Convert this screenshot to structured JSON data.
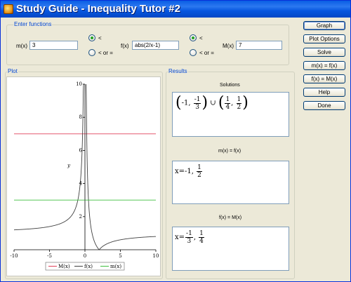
{
  "window": {
    "title": "Study Guide - Inequality Tutor #2"
  },
  "functions": {
    "group_label": "Enter functions",
    "m_label": "m(x)",
    "m_value": "3",
    "f_label": "f(x)",
    "f_value": "abs(2/x-1)",
    "M_label": "M(x)",
    "M_value": "7",
    "left_options": {
      "lt": "<",
      "le": "< or =",
      "selected": "lt"
    },
    "right_options": {
      "lt": "<",
      "le": "< or =",
      "selected": "lt"
    }
  },
  "plot": {
    "group_label": "Plot",
    "legend": [
      "M(x)",
      "f(x)",
      "m(x)"
    ]
  },
  "results": {
    "group_label": "Results",
    "solutions_title": "Solutions",
    "mf_title": "m(x) = f(x)",
    "fM_title": "f(x) = M(x)",
    "solutions": {
      "a1": "-1",
      "b1_num": "-1",
      "b1_den": "3",
      "union": "∪",
      "a2_num": "1",
      "a2_den": "4",
      "b2_num": "1",
      "b2_den": "2"
    },
    "mf": {
      "prefix": "x=",
      "v1": "-1",
      "v2_num": "1",
      "v2_den": "2"
    },
    "fM": {
      "prefix": "x=",
      "v1_num": "-1",
      "v1_den": "3",
      "v2_num": "1",
      "v2_den": "4"
    }
  },
  "buttons": {
    "graph": "Graph",
    "plot_options": "Plot Options",
    "solve": "Solve",
    "m_eq_f": "m(x) = f(x)",
    "f_eq_M": "f(x) = M(x)",
    "help": "Help",
    "done": "Done"
  },
  "colors": {
    "M": "#e0405a",
    "f": "#404040",
    "m": "#3fbf3f",
    "title_bar": "#0a5ee4",
    "group_label": "#0046d5"
  },
  "chart_data": {
    "type": "line",
    "xlim": [
      -10,
      10
    ],
    "ylim": [
      0,
      10
    ],
    "x_ticks": [
      "-10",
      "-5",
      "0",
      "5",
      "10"
    ],
    "y_ticks": [
      "2",
      "4",
      "6",
      "8",
      "10"
    ],
    "xlabel": "x",
    "ylabel": "y",
    "grid": false,
    "legend_position": "bottom",
    "series": [
      {
        "name": "M(x)",
        "expr": "7",
        "color": "#e0405a"
      },
      {
        "name": "f(x)",
        "expr": "abs(2/x-1)",
        "color": "#404040"
      },
      {
        "name": "m(x)",
        "expr": "3",
        "color": "#3fbf3f"
      }
    ]
  }
}
